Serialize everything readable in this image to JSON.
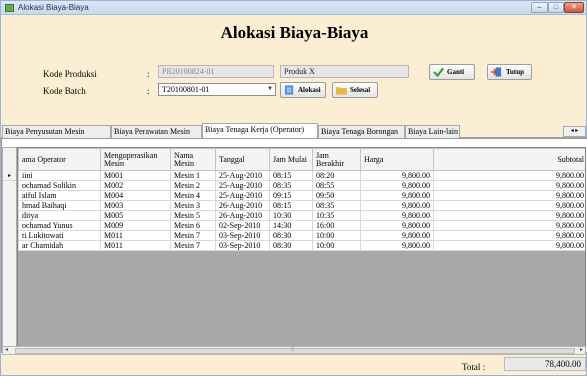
{
  "window": {
    "title": "Alokasi Biaya-Biaya",
    "min": "–",
    "max": "□",
    "close": "✕"
  },
  "heading": "Alokasi Biaya-Biaya",
  "form": {
    "kode_produksi_label": "Kode Produksi",
    "kode_batch_label": "Kode Batch",
    "colon": ":",
    "kode_produksi_value": "PR20100824-01",
    "produk_value": "Produk X",
    "kode_batch_value": "T20100801-01"
  },
  "buttons": {
    "ganti": "Ganti",
    "tutup": "Tutup",
    "alokasi": "Alokasi",
    "selesai": "Selesai"
  },
  "tabs": [
    {
      "label": "Biaya Penyusutan Mesin"
    },
    {
      "label": "Biaya Perawatan Mesin"
    },
    {
      "label": "Biaya Tenaga Kerja (Operator)"
    },
    {
      "label": "Biaya Tenaga Borongan"
    },
    {
      "label": "Biaya Lain-lain"
    }
  ],
  "tab_scroll": "◂ ▸",
  "grid": {
    "columns": [
      "ama Operator",
      "Mengoperasikan Mesin",
      "Nama Mesin",
      "Tanggal",
      "Jam Mulai",
      "Jam Berakhir",
      "Harga",
      "Subtotal"
    ],
    "current_row_marker": "▸",
    "rows": [
      [
        "iini",
        "M001",
        "Mesin 1",
        "25-Aug-2010",
        "08:15",
        "08:20",
        "9,800.00",
        "9,800.00"
      ],
      [
        "ochamad Solikin",
        "M002",
        "Mesin 2",
        "25-Aug-2010",
        "08:35",
        "08:55",
        "9,800.00",
        "9,800.00"
      ],
      [
        "aiful Islam",
        "M004",
        "Mesin 4",
        "25-Aug-2010",
        "09:15",
        "09:50",
        "9,800.00",
        "9,800.00"
      ],
      [
        "hmad Baihaqi",
        "M003",
        "Mesin 3",
        "26-Aug-2010",
        "08:15",
        "08:35",
        "9,800.00",
        "9,800.00"
      ],
      [
        "ditya",
        "M005",
        "Mesin 5",
        "26-Aug-2010",
        "10:30",
        "10:35",
        "9,800.00",
        "9,800.00"
      ],
      [
        "ochamad Yunus",
        "M009",
        "Mesin 6",
        "02-Sep-2010",
        "14:30",
        "16:00",
        "9,800.00",
        "9,800.00"
      ],
      [
        "ti Lukitowati",
        "M011",
        "Mesin 7",
        "03-Sep-2010",
        "08:30",
        "10:00",
        "9,800.00",
        "9,800.00"
      ],
      [
        "ar Chamidah",
        "M011",
        "Mesin 7",
        "03-Sep-2010",
        "08:30",
        "10:00",
        "9,800.00",
        "9,800.00"
      ]
    ]
  },
  "scroll": {
    "left": "◂",
    "right": "▸",
    "thumb_mark": "|||"
  },
  "total": {
    "label": "Total   :",
    "value": "78,400.00"
  }
}
